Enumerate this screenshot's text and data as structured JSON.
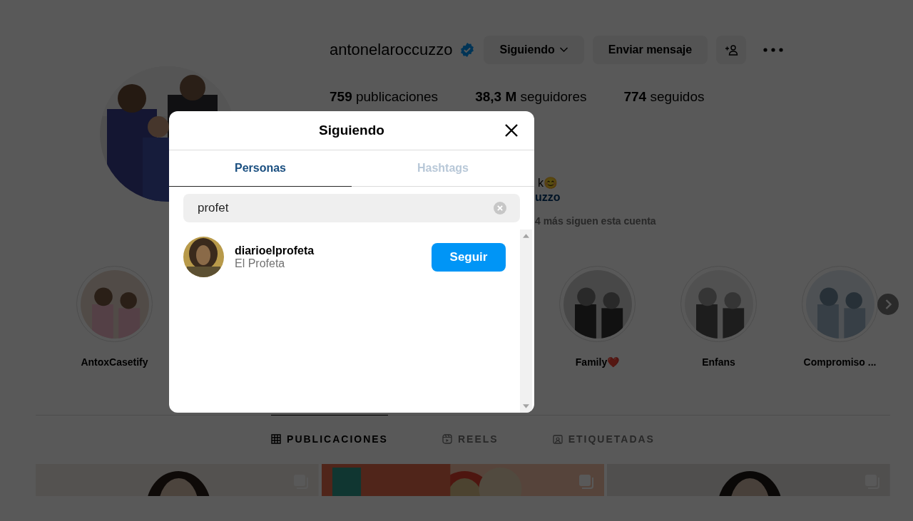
{
  "profile": {
    "username": "antonelaroccuzzo",
    "following_button": "Siguiendo",
    "message_button": "Enviar mensaje",
    "stats": [
      {
        "value": "759",
        "label": "publicaciones"
      },
      {
        "value": "38,3 M",
        "label": "seguidores"
      },
      {
        "value": "774",
        "label": "seguidos"
      }
    ],
    "bio_fragments": [
      "k😊",
      "uzzo"
    ],
    "followed_by": "4 más siguen esta cuenta"
  },
  "highlights": [
    {
      "title": "AntoxCasetify"
    },
    {
      "title": "Family❤️"
    },
    {
      "title": "Enfans"
    },
    {
      "title": "Compromiso ..."
    }
  ],
  "profile_tabs": [
    {
      "label": "PUBLICACIONES",
      "selected": true
    },
    {
      "label": "REELS",
      "selected": false
    },
    {
      "label": "ETIQUETADAS",
      "selected": false
    }
  ],
  "modal": {
    "title": "Siguiendo",
    "tabs": [
      {
        "label": "Personas",
        "selected": true
      },
      {
        "label": "Hashtags",
        "selected": false
      }
    ],
    "search": {
      "value": "profet"
    },
    "results": [
      {
        "username": "diarioelprofeta",
        "name": "El Profeta",
        "button": "Seguir"
      }
    ]
  }
}
